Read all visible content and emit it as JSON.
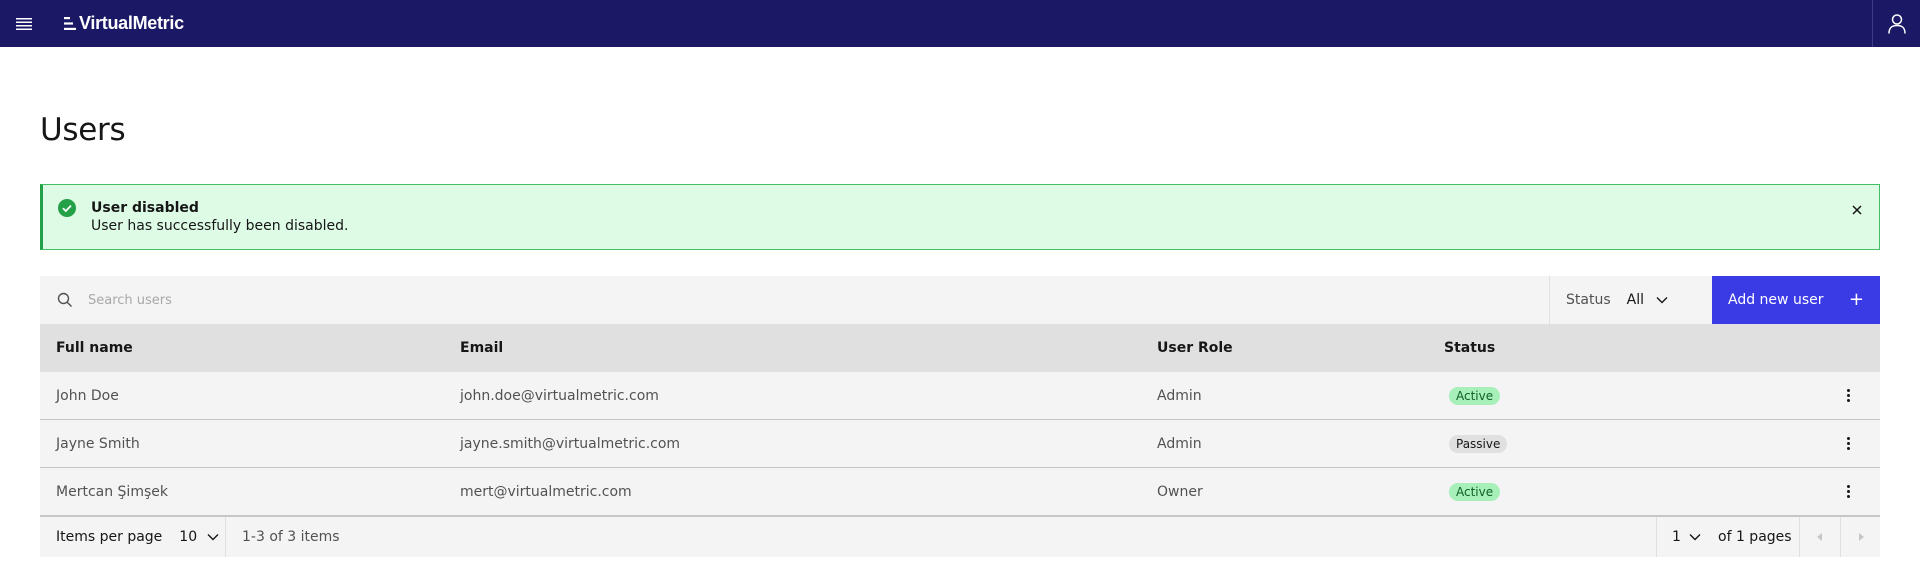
{
  "header": {
    "brand": "VirtualMetric",
    "menu_icon": "hamburger-menu-icon",
    "user_icon": "user-icon",
    "bg_color": "#1b1966"
  },
  "page": {
    "title": "Users"
  },
  "notification": {
    "title": "User disabled",
    "message": "User has successfully been disabled.",
    "icon": "checkmark-filled-icon",
    "color": "#24a148"
  },
  "toolbar": {
    "search_placeholder": "Search users",
    "status_label": "Status",
    "status_value": "All",
    "add_button_label": "Add new user",
    "add_button_icon": "+",
    "add_button_color": "#3b3be6"
  },
  "table": {
    "columns": [
      "Full name",
      "Email",
      "User Role",
      "Status"
    ],
    "rows": [
      {
        "name": "John Doe",
        "email": "john.doe@virtualmetric.com",
        "role": "Admin",
        "status": "Active"
      },
      {
        "name": "Jayne Smith",
        "email": "jayne.smith@virtualmetric.com",
        "role": "Admin",
        "status": "Passive"
      },
      {
        "name": "Mertcan Şimşek",
        "email": "mert@virtualmetric.com",
        "role": "Owner",
        "status": "Active"
      }
    ]
  },
  "pagination": {
    "items_per_page_label": "Items per page",
    "items_per_page_value": "10",
    "range_text": "1-3 of 3 items",
    "page_value": "1",
    "page_total_text": "of 1 pages"
  }
}
